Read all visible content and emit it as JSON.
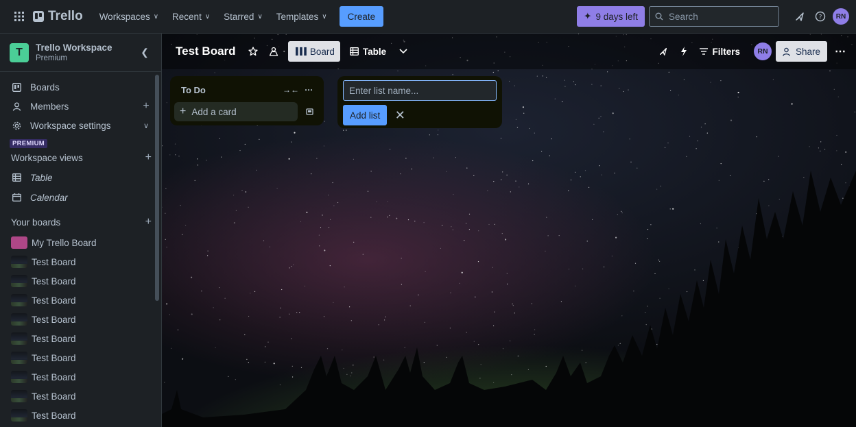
{
  "topnav": {
    "app_name": "Trello",
    "menus": [
      "Workspaces",
      "Recent",
      "Starred",
      "Templates"
    ],
    "create_label": "Create",
    "trial_label": "9 days left",
    "search_placeholder": "Search",
    "avatar_initials": "RN"
  },
  "sidebar": {
    "workspace_initial": "T",
    "workspace_name": "Trello Workspace",
    "workspace_plan": "Premium",
    "nav": [
      {
        "label": "Boards"
      },
      {
        "label": "Members"
      },
      {
        "label": "Workspace settings"
      }
    ],
    "premium_tag": "PREMIUM",
    "views_heading": "Workspace views",
    "views": [
      "Table",
      "Calendar"
    ],
    "boards_heading": "Your boards",
    "boards": [
      "My Trello Board",
      "Test Board",
      "Test Board",
      "Test Board",
      "Test Board",
      "Test Board",
      "Test Board",
      "Test Board",
      "Test Board",
      "Test Board"
    ]
  },
  "board": {
    "title": "Test Board",
    "view_board_label": "Board",
    "view_table_label": "Table",
    "filters_label": "Filters",
    "member_initials": "RN",
    "share_label": "Share"
  },
  "lists": [
    {
      "title": "To Do",
      "add_card_label": "Add a card"
    }
  ],
  "new_list": {
    "placeholder": "Enter list name...",
    "add_label": "Add list"
  },
  "colors": {
    "accent_blue": "#579dff",
    "trial_purple": "#8f7ee7",
    "workspace_green": "#4bce97",
    "board_pink": "#ae4787"
  }
}
